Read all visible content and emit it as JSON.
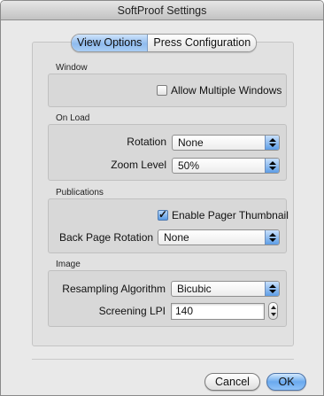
{
  "window": {
    "title": "SoftProof Settings"
  },
  "tabs": [
    {
      "label": "View Options",
      "active": true
    },
    {
      "label": "Press Configuration",
      "active": false
    }
  ],
  "sections": {
    "window": {
      "label": "Window",
      "allow_multiple_windows": {
        "label": "Allow Multiple Windows",
        "checked": false
      }
    },
    "on_load": {
      "label": "On Load",
      "rotation": {
        "label": "Rotation",
        "value": "None"
      },
      "zoom_level": {
        "label": "Zoom Level",
        "value": "50%"
      }
    },
    "publications": {
      "label": "Publications",
      "enable_pager_thumbnail": {
        "label": "Enable Pager Thumbnail",
        "checked": true
      },
      "back_page_rotation": {
        "label": "Back Page Rotation",
        "value": "None"
      }
    },
    "image": {
      "label": "Image",
      "resampling_algorithm": {
        "label": "Resampling Algorithm",
        "value": "Bicubic"
      },
      "screening_lpi": {
        "label": "Screening LPI",
        "value": "140"
      }
    }
  },
  "buttons": {
    "cancel": "Cancel",
    "ok": "OK"
  },
  "colors": {
    "accent": "#6aa9ee",
    "window_bg": "#e9e9e9"
  }
}
